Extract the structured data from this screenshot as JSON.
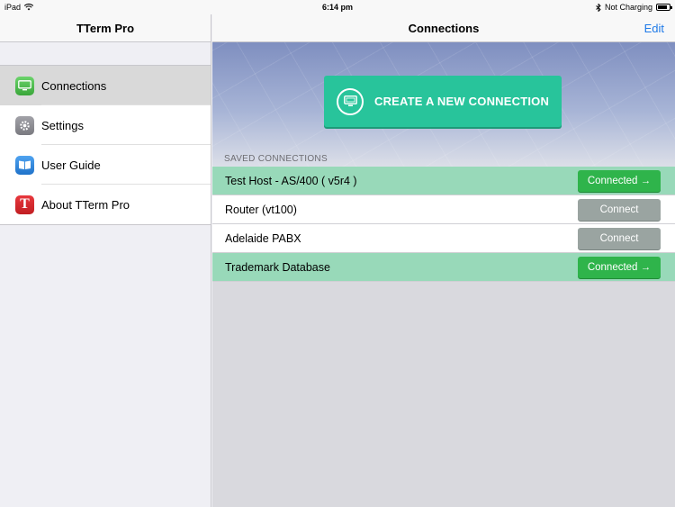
{
  "status_bar": {
    "device": "iPad",
    "time": "6:14 pm",
    "charging": "Not Charging",
    "battery_level": 0.85
  },
  "sidebar": {
    "title": "TTerm Pro",
    "items": [
      {
        "label": "Connections",
        "icon": "monitor-icon",
        "active": true
      },
      {
        "label": "Settings",
        "icon": "gear-icon",
        "active": false
      },
      {
        "label": "User Guide",
        "icon": "book-icon",
        "active": false
      },
      {
        "label": "About TTerm Pro",
        "icon": "tterm-logo-icon",
        "active": false
      }
    ]
  },
  "main": {
    "title": "Connections",
    "edit_label": "Edit",
    "create_button": "CREATE A NEW CONNECTION",
    "section_label": "SAVED CONNECTIONS",
    "connections": [
      {
        "name": "Test Host - AS/400 ( v5r4 )",
        "button": "Connected →",
        "connected": true
      },
      {
        "name": "Router (vt100)",
        "button": "Connect",
        "connected": false
      },
      {
        "name": "Adelaide PABX",
        "button": "Connect",
        "connected": false
      },
      {
        "name": "Trademark Database",
        "button": "Connected →",
        "connected": true
      }
    ]
  },
  "colors": {
    "accent": "#1f7ae8",
    "create_button": "#28c49b",
    "connected_row": "#98d9b9",
    "connected_button": "#2fb44b",
    "connect_button": "#9aa4a1"
  }
}
